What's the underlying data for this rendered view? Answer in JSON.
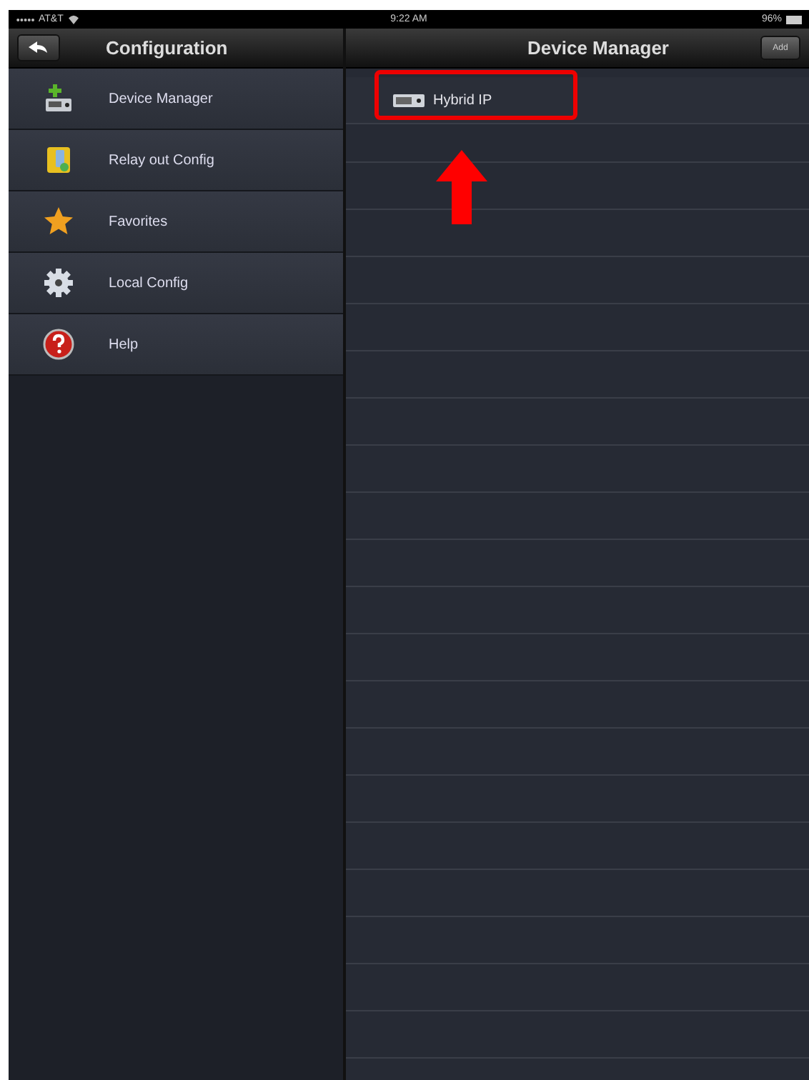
{
  "status_bar": {
    "carrier": "AT&T",
    "time": "9:22 AM",
    "battery": "96%"
  },
  "sidebar": {
    "title": "Configuration",
    "items": [
      {
        "label": "Device Manager",
        "kind": "device"
      },
      {
        "label": "Relay out Config",
        "kind": "relay"
      },
      {
        "label": "Favorites",
        "kind": "star"
      },
      {
        "label": "Local Config",
        "kind": "gear"
      },
      {
        "label": "Help",
        "kind": "help"
      }
    ]
  },
  "main": {
    "title": "Device Manager",
    "add_button": "Add",
    "devices": [
      {
        "label": "Hybrid IP"
      }
    ]
  }
}
